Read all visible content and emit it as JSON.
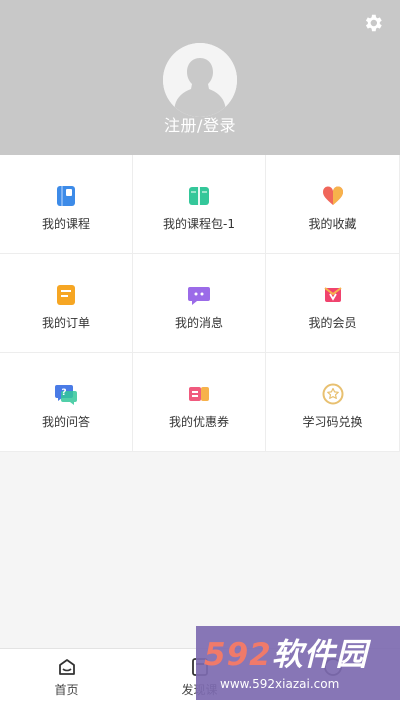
{
  "header": {
    "login_text": "注册/登录"
  },
  "grid": [
    {
      "label": "我的课程",
      "icon": "course-book-icon",
      "color": "#3d8be8"
    },
    {
      "label": "我的课程包-1",
      "icon": "course-package-icon",
      "color": "#34c79a"
    },
    {
      "label": "我的收藏",
      "icon": "heart-favorite-icon",
      "color": "#f0665a"
    },
    {
      "label": "我的订单",
      "icon": "order-icon",
      "color": "#f6a623"
    },
    {
      "label": "我的消息",
      "icon": "message-icon",
      "color": "#9b6be8"
    },
    {
      "label": "我的会员",
      "icon": "vip-member-icon",
      "color": "#f0436e"
    },
    {
      "label": "我的问答",
      "icon": "qa-icon",
      "color": "#4a7be6"
    },
    {
      "label": "我的优惠券",
      "icon": "coupon-icon",
      "color": "#f05a7e"
    },
    {
      "label": "学习码兑换",
      "icon": "star-badge-icon",
      "color": "#e8c070"
    }
  ],
  "bottom_nav": [
    {
      "label": "首页",
      "icon": "home-icon"
    },
    {
      "label": "发现课",
      "icon": "discover-icon"
    },
    {
      "label": "",
      "icon": "profile-icon"
    }
  ],
  "watermark": {
    "brand_num": "592",
    "brand_text": "软件园",
    "url": "www.592xiazai.com"
  }
}
